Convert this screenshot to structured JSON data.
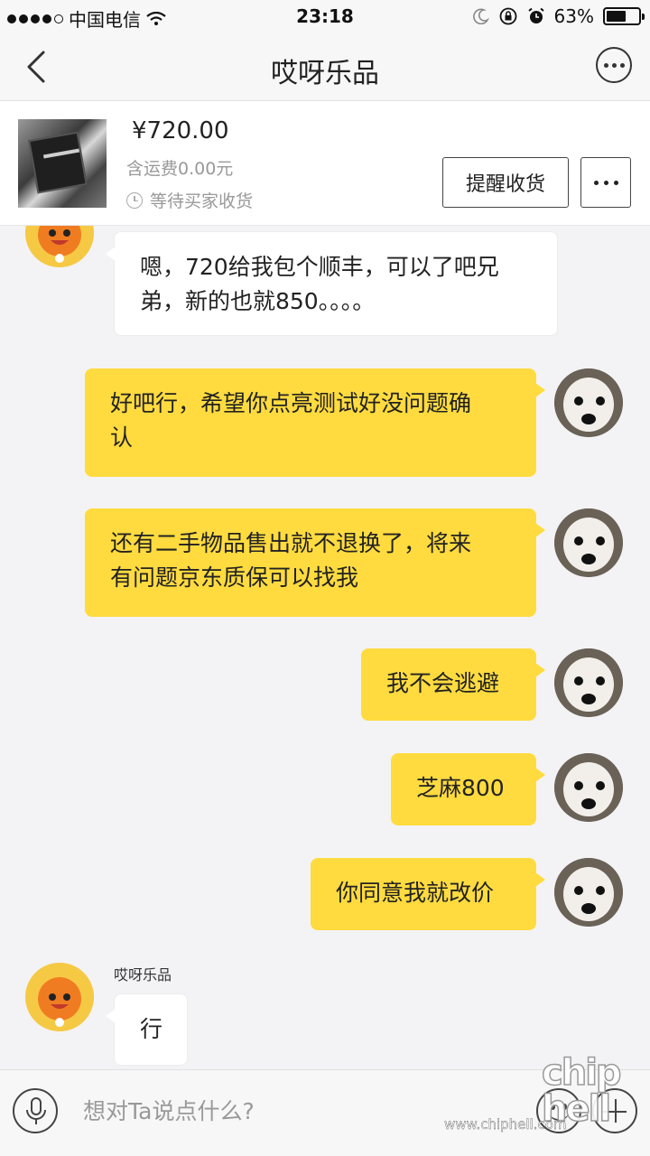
{
  "status_bar": {
    "carrier": "中国电信",
    "time": "23:18",
    "battery": "63%",
    "battery_level": 0.63,
    "icons": [
      "signal-dots-icon",
      "wifi-icon",
      "moon-icon",
      "orientation-lock-icon",
      "alarm-icon",
      "battery-icon"
    ]
  },
  "nav": {
    "title": "哎呀乐品",
    "icons": [
      "back-chevron-icon",
      "more-circle-icon"
    ]
  },
  "product": {
    "price": "¥720.00",
    "shipping": "含运费0.00元",
    "status": "等待买家收货",
    "remind_label": "提醒收货",
    "more_label": "•••"
  },
  "messages": [
    {
      "side": "in",
      "text_lines": [
        "嗯，720给我包个顺丰，可以了吧兄",
        "弟，新的也就850。。。。"
      ]
    },
    {
      "side": "out",
      "text_lines": [
        "好吧行，希望你点亮测试好没问题确",
        "认"
      ]
    },
    {
      "side": "out",
      "text_lines": [
        "还有二手物品售出就不退换了，将来",
        "有问题京东质保可以找我"
      ]
    },
    {
      "side": "out",
      "text_lines": [
        "我不会逃避"
      ]
    },
    {
      "side": "out",
      "text_lines": [
        "芝麻800"
      ]
    },
    {
      "side": "out",
      "text_lines": [
        "你同意我就改价"
      ]
    },
    {
      "side": "in",
      "sender": "哎呀乐品",
      "text_lines": [
        "行"
      ]
    }
  ],
  "input_bar": {
    "placeholder": "想对Ta说点什么?",
    "icons": [
      "microphone-icon",
      "emoji-icon",
      "plus-icon"
    ]
  },
  "watermark": {
    "logo": "chip hell",
    "url": "www.chiphell.com"
  },
  "colors": {
    "outgoing_bubble": "#ffdb3f",
    "incoming_bubble": "#ffffff",
    "background": "#f3f3f5"
  }
}
